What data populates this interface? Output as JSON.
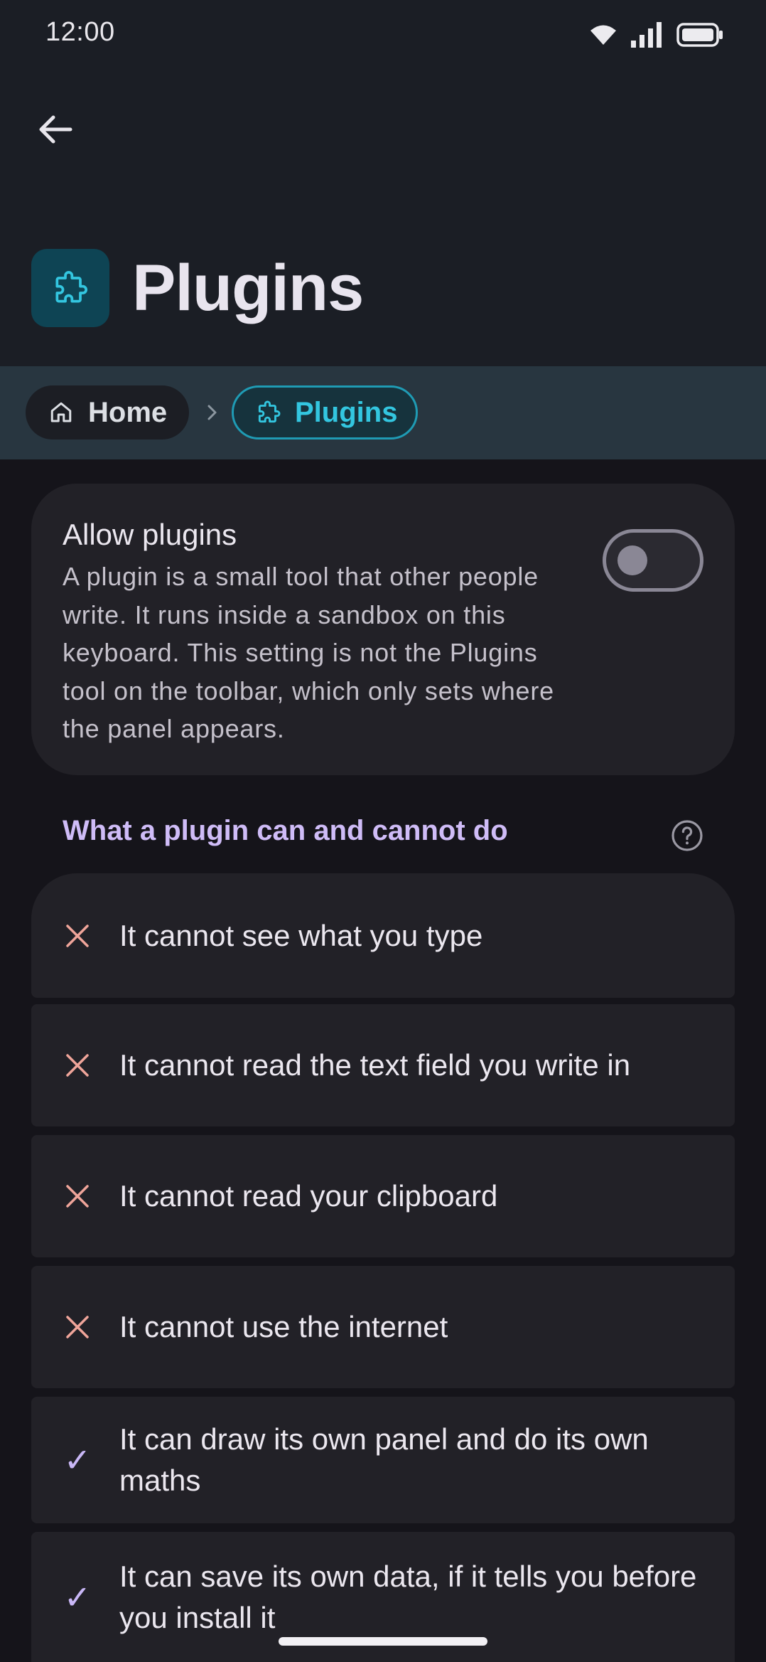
{
  "status_bar": {
    "time": "12:00"
  },
  "header": {
    "back_icon": "arrow-left-icon",
    "title_icon": "puzzle-icon",
    "title": "Plugins"
  },
  "breadcrumb": {
    "home_label": "Home",
    "current_label": "Plugins"
  },
  "allow_card": {
    "title": "Allow plugins",
    "description": "A plugin is a small tool that other people write. It runs inside a sandbox on this keyboard. This setting is not the Plugins tool on the toolbar, which only sets where the panel appears.",
    "toggle_on": false
  },
  "capabilities": {
    "section_title": "What a plugin can and cannot do",
    "items": [
      {
        "text": "It cannot see what you type",
        "allowed": false
      },
      {
        "text": "It cannot read the text field you write in",
        "allowed": false
      },
      {
        "text": "It cannot read your clipboard",
        "allowed": false
      },
      {
        "text": "It cannot use the internet",
        "allowed": false
      },
      {
        "text": "It can draw its own panel and do its own maths",
        "allowed": true
      },
      {
        "text": "It can save its own data, if it tells you before you install it",
        "allowed": true
      }
    ]
  },
  "colors": {
    "accent_cyan": "#33c6e0",
    "accent_purple": "#cfbcf7",
    "deny_red": "#f0a59a"
  }
}
